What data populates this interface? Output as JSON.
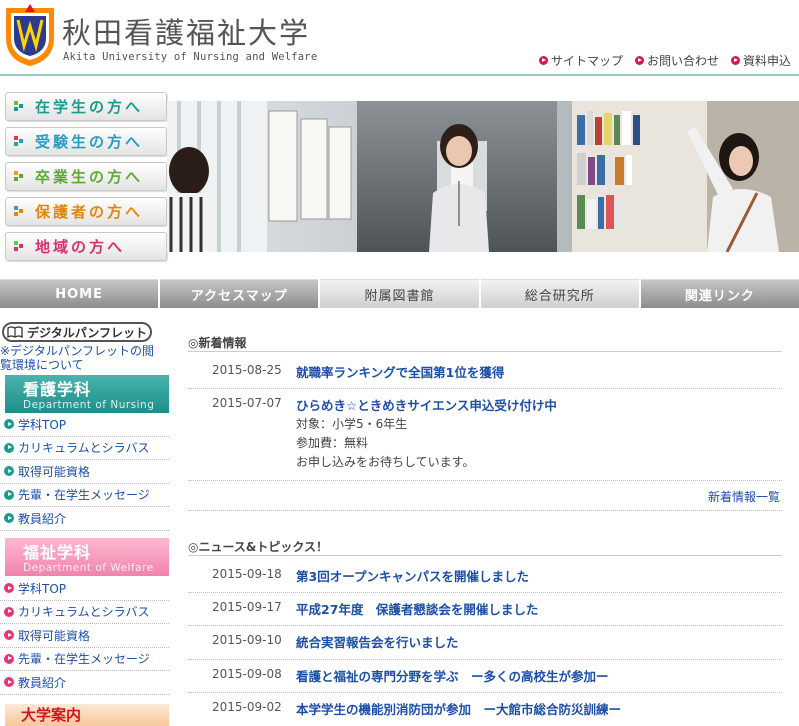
{
  "header": {
    "title": "秋田看護福祉大学",
    "subtitle": "Akita University of Nursing and Welfare",
    "util_links": [
      {
        "label": "サイトマップ"
      },
      {
        "label": "お問い合わせ"
      },
      {
        "label": "資料申込"
      }
    ],
    "accent_color": "#d7145c"
  },
  "audience_buttons": [
    {
      "label": "在学生の方へ",
      "color": "#1b9a8e",
      "mark_color": "#6fbf49"
    },
    {
      "label": "受験生の方へ",
      "color": "#2a9cc4",
      "mark_color": "#e23a3a"
    },
    {
      "label": "卒業生の方へ",
      "color": "#5faa36",
      "mark_color": "#e99a28"
    },
    {
      "label": "保護者の方へ",
      "color": "#e4860d",
      "mark_color": "#3a98d6"
    },
    {
      "label": "地域の方へ",
      "color": "#d6336c",
      "mark_color": "#6fbf49"
    }
  ],
  "nav": [
    {
      "label": "HOME"
    },
    {
      "label": "アクセスマップ"
    },
    {
      "label": "附属図書館"
    },
    {
      "label": "総合研究所"
    },
    {
      "label": "関連リンク"
    }
  ],
  "sidebar": {
    "pamphlet_label": "デジタルパンフレット",
    "pamphlet_note": "※デジタルパンフレットの閲覧環境について",
    "nursing": {
      "jp": "看護学科",
      "en": "Department of Nursing",
      "links": [
        "学科TOP",
        "カリキュラムとシラバス",
        "取得可能資格",
        "先輩・在学生メッセージ",
        "教員紹介"
      ],
      "dot_color": "#1b9a8e"
    },
    "welfare": {
      "jp": "福祉学科",
      "en": "Department of Welfare",
      "links": [
        "学科TOP",
        "カリキュラムとシラバス",
        "取得可能資格",
        "先輩・在学生メッセージ",
        "教員紹介"
      ],
      "dot_color": "#e8337a"
    },
    "guide_label": "大学案内"
  },
  "news": {
    "heading": "◎新着情報",
    "items": [
      {
        "date": "2015-08-25",
        "title": "就職率ランキングで全国第1位を獲得"
      },
      {
        "date": "2015-07-07",
        "title": "ひらめき☆ときめきサイエンス申込受け付け中",
        "body": [
          "対象：小学5・6年生",
          "参加費：無料",
          "お申し込みをお待ちしています。"
        ]
      }
    ],
    "more_label": "新着情報一覧"
  },
  "topics": {
    "heading": "◎ニュース&トピックス！",
    "items": [
      {
        "date": "2015-09-18",
        "title": "第3回オープンキャンパスを開催しました"
      },
      {
        "date": "2015-09-17",
        "title": "平成27年度　保護者懇談会を開催しました"
      },
      {
        "date": "2015-09-10",
        "title": "統合実習報告会を行いました"
      },
      {
        "date": "2015-09-08",
        "title": "看護と福祉の専門分野を学ぶ　ー多くの高校生が参加ー"
      },
      {
        "date": "2015-09-02",
        "title": "本学学生の機能別消防団が参加　ー大館市総合防災訓練ー"
      }
    ]
  }
}
